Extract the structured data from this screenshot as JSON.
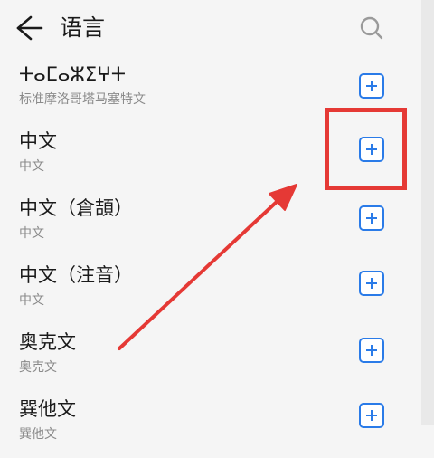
{
  "header": {
    "title": "语言",
    "back_icon": "arrow-left-icon",
    "search_icon": "search-icon"
  },
  "languages": [
    {
      "name": "ⵜⴰⵎⴰⵣⵉⵖⵜ",
      "native": "标准摩洛哥塔马塞特文"
    },
    {
      "name": "中文",
      "native": "中文"
    },
    {
      "name": "中文（倉頡）",
      "native": "中文"
    },
    {
      "name": "中文（注音）",
      "native": "中文"
    },
    {
      "name": "奥克文",
      "native": "奥克文"
    },
    {
      "name": "巽他文",
      "native": "巽他文"
    }
  ],
  "colors": {
    "accent": "#2a7be8",
    "annotation": "#e53935"
  }
}
